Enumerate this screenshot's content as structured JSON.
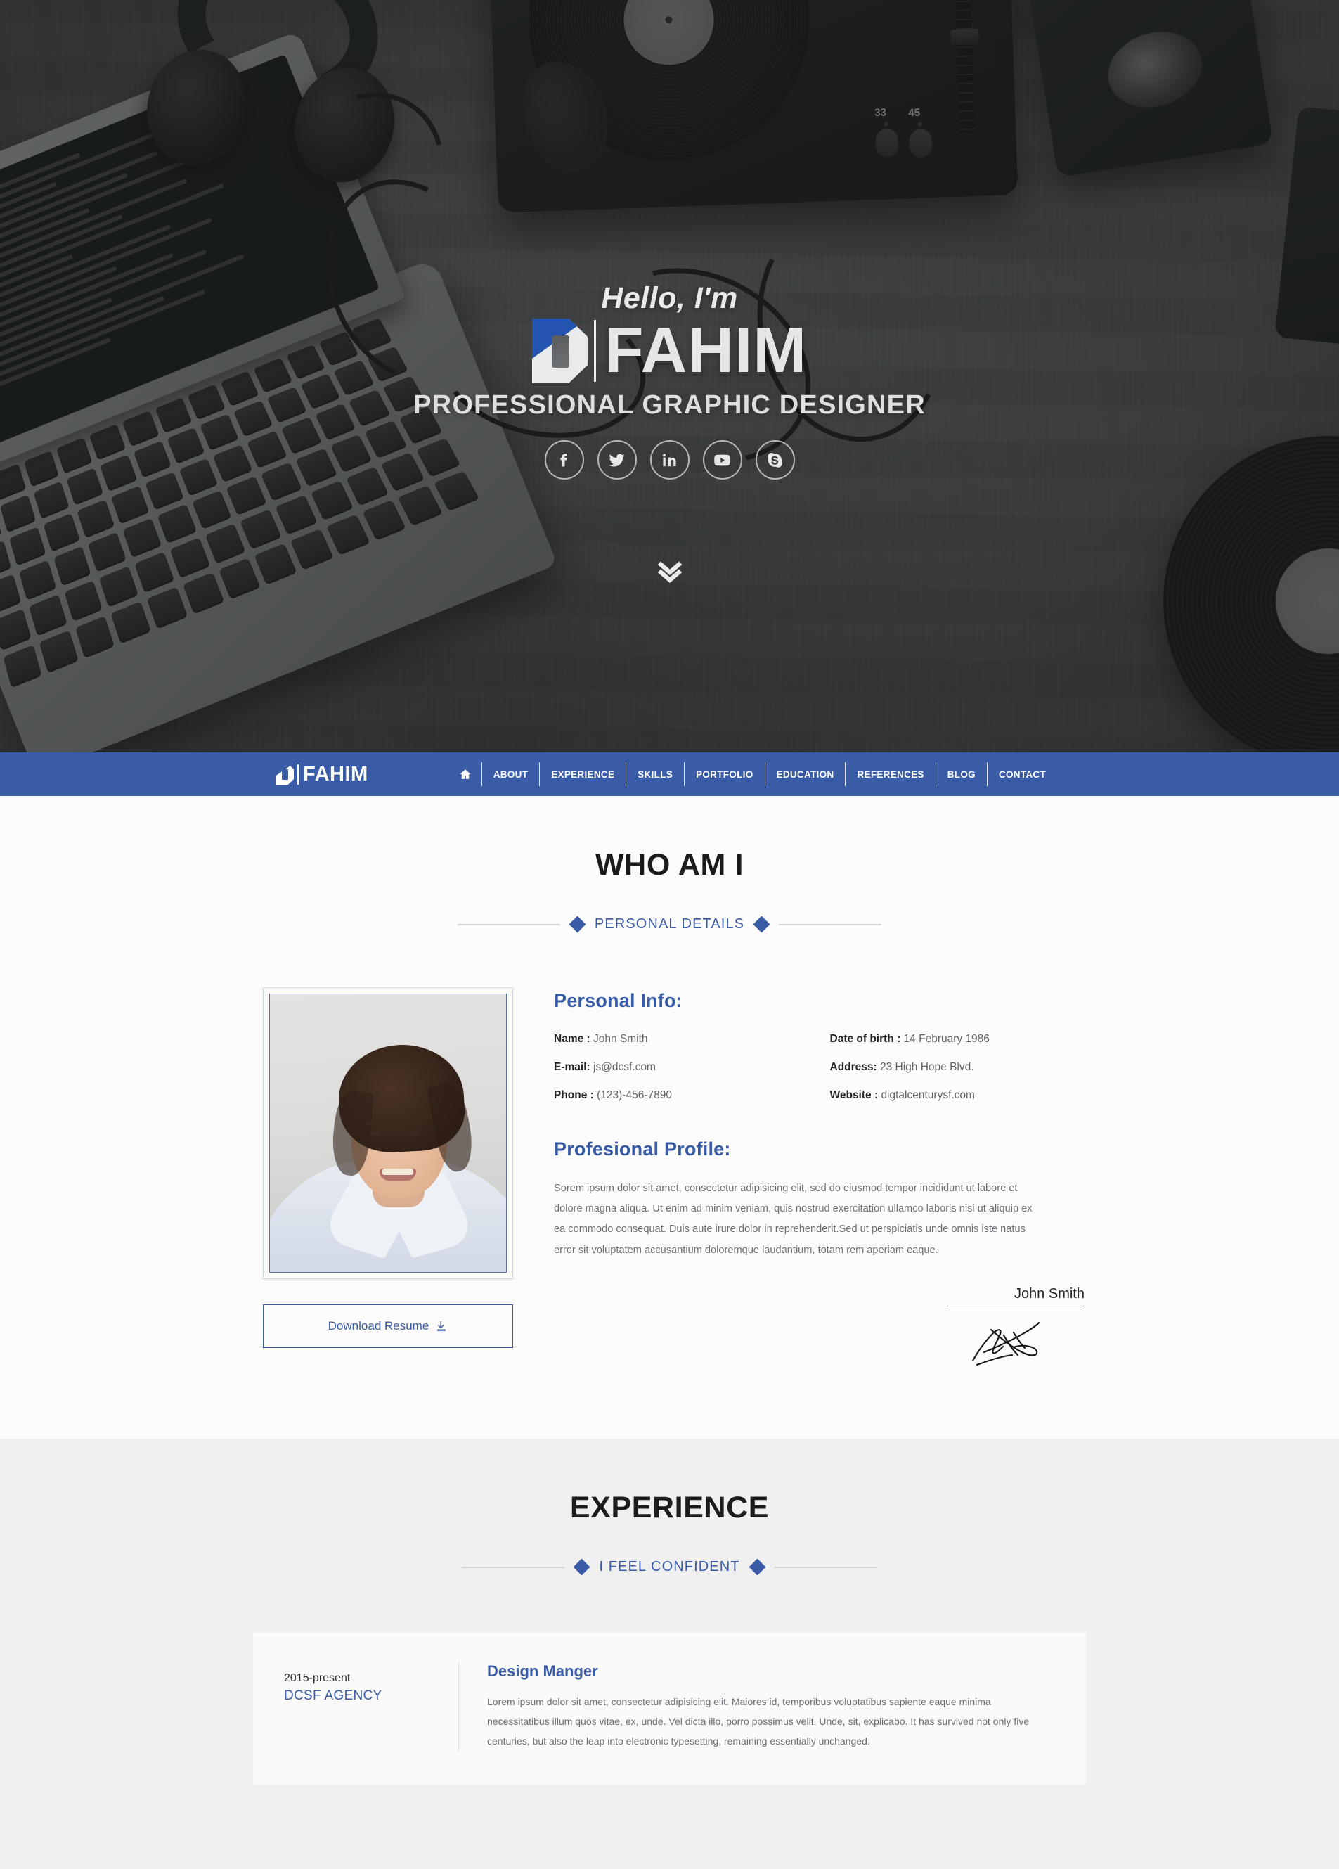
{
  "hero": {
    "greeting": "Hello, I'm",
    "name": "FAHIM",
    "tagline": "PROFESSIONAL GRAPHIC DESIGNER",
    "socials": [
      {
        "name": "facebook",
        "label": "Facebook"
      },
      {
        "name": "twitter",
        "label": "Twitter"
      },
      {
        "name": "linkedin",
        "label": "LinkedIn"
      },
      {
        "name": "youtube",
        "label": "YouTube"
      },
      {
        "name": "skype",
        "label": "Skype"
      }
    ],
    "scroll_icon": "chevron-double-down-icon",
    "turntable": {
      "speed_33": "33",
      "speed_45": "45"
    }
  },
  "nav": {
    "logo_text": "FAHIM",
    "home_icon": "home-icon",
    "items": [
      {
        "label": "ABOUT"
      },
      {
        "label": "EXPERIENCE"
      },
      {
        "label": "SKILLS"
      },
      {
        "label": "PORTFOLIO"
      },
      {
        "label": "EDUCATION"
      },
      {
        "label": "REFERENCES"
      },
      {
        "label": "BLOG"
      },
      {
        "label": "CONTACT"
      }
    ]
  },
  "about": {
    "title": "WHO AM I",
    "subtitle": "PERSONAL DETAILS",
    "info_heading": "Personal Info:",
    "info": [
      {
        "label": "Name :",
        "value": "John Smith"
      },
      {
        "label": "Date of birth :",
        "value": "14 February 1986"
      },
      {
        "label": "E-mail:",
        "value": "js@dcsf.com"
      },
      {
        "label": "Address:",
        "value": "23 High Hope Blvd."
      },
      {
        "label": "Phone :",
        "value": "(123)-456-7890"
      },
      {
        "label": "Website :",
        "value": "digtalcenturysf.com"
      }
    ],
    "profile_heading": "Profesional Profile:",
    "profile_text": "Sorem ipsum dolor sit amet, consectetur adipisicing elit, sed do eiusmod tempor incididunt ut labore et dolore magna aliqua. Ut enim ad minim veniam, quis nostrud exercitation ullamco laboris nisi ut aliquip ex ea commodo consequat. Duis aute irure dolor in reprehenderit.Sed ut perspiciatis unde omnis iste natus error sit voluptatem accusantium doloremque laudantium, totam rem aperiam eaque.",
    "resume_button": "Download Resume",
    "resume_icon": "download-icon",
    "signature_name": "John Smith",
    "photo_alt": "portrait-photo"
  },
  "experience": {
    "title": "EXPERIENCE",
    "subtitle": "I FEEL CONFIDENT",
    "entries": [
      {
        "date": "2015-present",
        "company": "DCSF AGENCY",
        "role": "Design Manger",
        "description": "Lorem ipsum dolor sit amet, consectetur adipisicing elit. Maiores id, temporibus voluptatibus sapiente eaque minima necessitatibus illum quos vitae, ex, unde. Vel dicta illo, porro possimus velit. Unde, sit, explicabo. It has survived not only five centuries, but also the leap into electronic typesetting, remaining essentially unchanged."
      }
    ]
  },
  "colors": {
    "brand_blue": "#3a5ba5",
    "logo_blue": "#2554b0",
    "section_grey": "#f0f0f0",
    "body_text": "#6b6f73",
    "heading_dark": "#1b1c1e"
  }
}
